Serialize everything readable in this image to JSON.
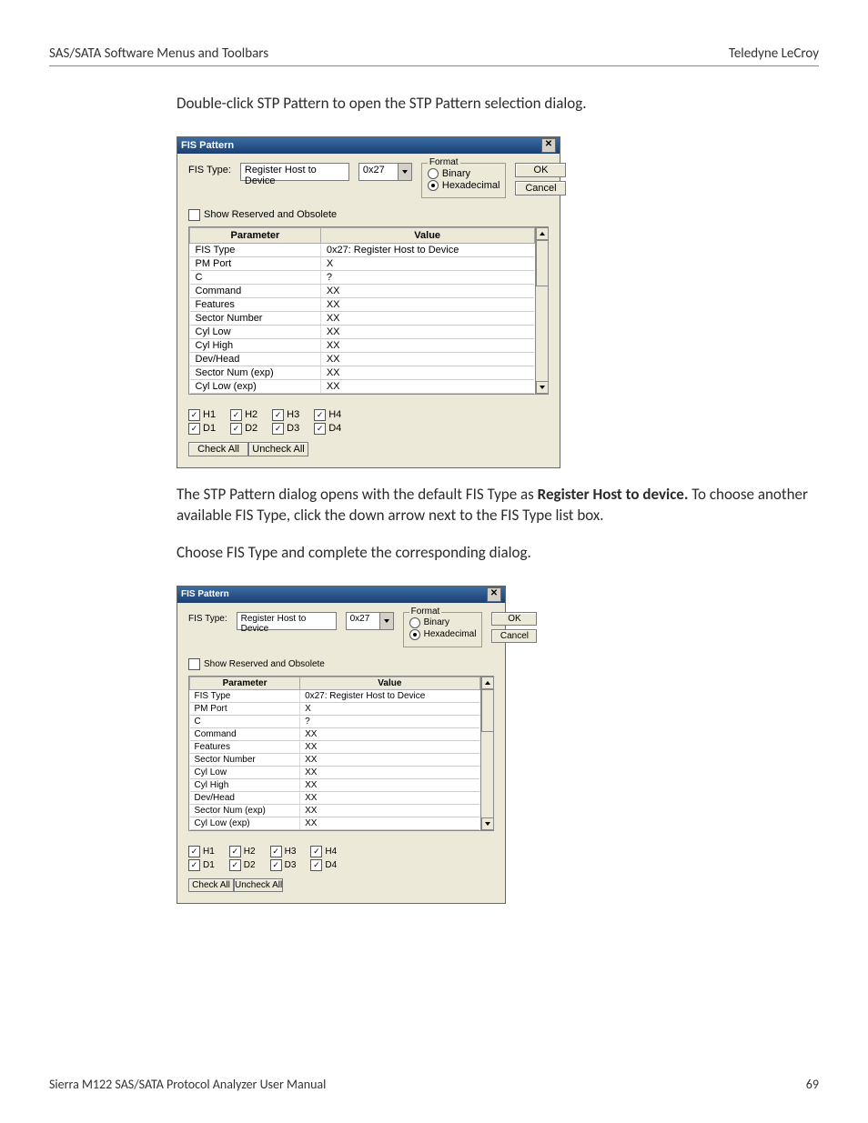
{
  "header": {
    "left": "SAS/SATA Software Menus and Toolbars",
    "right": "Teledyne LeCroy"
  },
  "para1": "Double-click STP Pattern to open the STP Pattern selection dialog.",
  "para2_a": "The STP Pattern dialog opens with the default FIS Type as ",
  "para2_b": "Register Host to device.",
  "para2_c": " To choose another available FIS Type, click the down arrow next to the FIS Type list box.",
  "para3": "Choose FIS Type and complete the corresponding dialog.",
  "footer": {
    "left": "Sierra M122 SAS/SATA Protocol Analyzer User Manual",
    "right": "69"
  },
  "dialog": {
    "title": "FIS Pattern",
    "fis_type_label": "FIS Type:",
    "fis_type_value": "Register Host to Device",
    "code_value": "0x27",
    "format": {
      "legend": "Format",
      "binary": "Binary",
      "hex": "Hexadecimal",
      "selected": "hex"
    },
    "ok": "OK",
    "cancel": "Cancel",
    "show_reserved": "Show Reserved and Obsolete",
    "columns": {
      "param": "Parameter",
      "value": "Value"
    },
    "rows": [
      {
        "p": "FIS Type",
        "v": "0x27: Register Host to Device"
      },
      {
        "p": "PM Port",
        "v": "X"
      },
      {
        "p": "C",
        "v": "?"
      },
      {
        "p": "Command",
        "v": "XX"
      },
      {
        "p": "Features",
        "v": "XX"
      },
      {
        "p": "Sector Number",
        "v": "XX"
      },
      {
        "p": "Cyl Low",
        "v": "XX"
      },
      {
        "p": "Cyl High",
        "v": "XX"
      },
      {
        "p": "Dev/Head",
        "v": "XX"
      },
      {
        "p": "Sector Num (exp)",
        "v": "XX"
      },
      {
        "p": "Cyl Low (exp)",
        "v": "XX"
      }
    ],
    "ports": {
      "h": [
        "H1",
        "H2",
        "H3",
        "H4"
      ],
      "d": [
        "D1",
        "D2",
        "D3",
        "D4"
      ]
    },
    "check_all": "Check All",
    "uncheck_all": "Uncheck All",
    "checkmark": "✓"
  }
}
